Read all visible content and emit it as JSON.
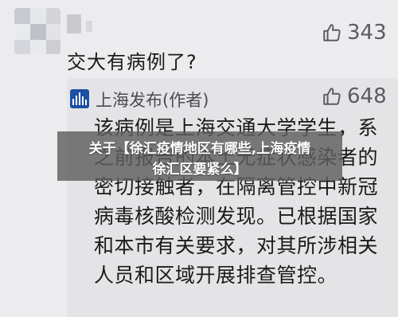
{
  "top_comment": {
    "text": "交大有病例了?",
    "likes": "343"
  },
  "reply": {
    "author": "上海发布(作者)",
    "likes": "648",
    "body": "该病例是上海交通大学学生，系之前报告的本土无症状感染者的密切接触者，在隔离管控中新冠病毒核酸检测发现。已根据国家和本市有关要求，对其所涉相关人员和区域开展排查管控。"
  },
  "banner": {
    "line1": "关于【徐汇疫情地区有哪些,上海疫情",
    "line2": "徐汇区要紧么】"
  },
  "icons": {
    "like": "thumbs-up-icon",
    "avatar_user": "blurred-avatar",
    "avatar_reply": "shanghai-fabu-logo"
  },
  "colors": {
    "background": "#ececee",
    "reply_background": "#e4e4e6",
    "like_icon": "#5a5b63",
    "banner_overlay": "#5f5f5f"
  }
}
